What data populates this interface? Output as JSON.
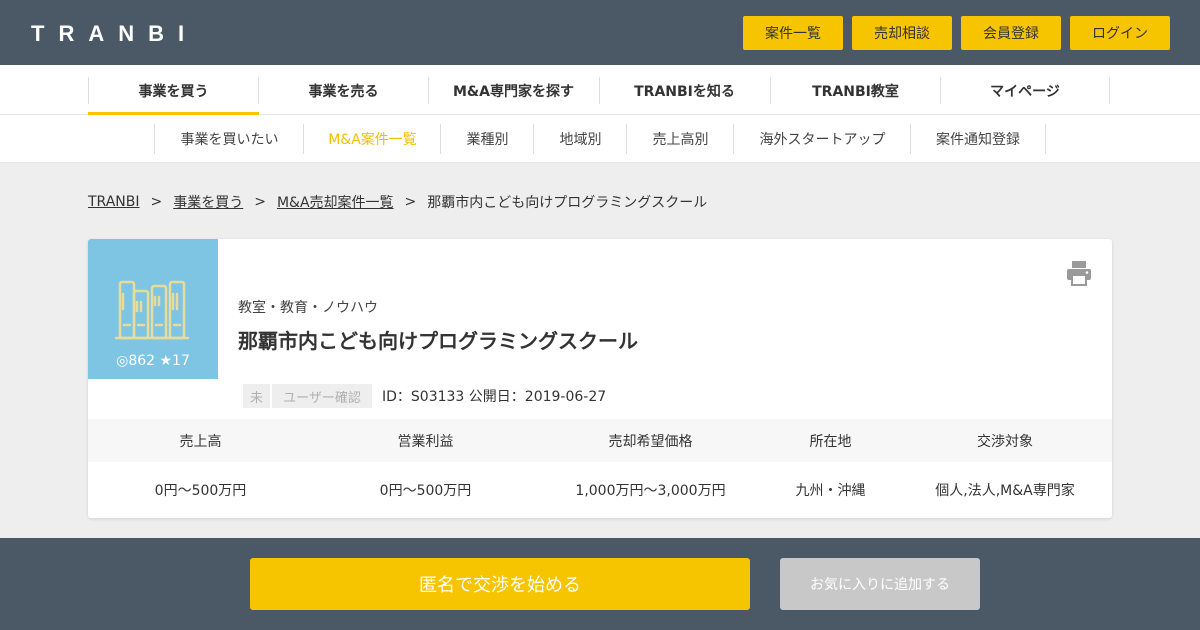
{
  "header": {
    "logo": "TRANBI",
    "buttons": [
      "案件一覧",
      "売却相談",
      "会員登録",
      "ログイン"
    ]
  },
  "main_nav": {
    "items": [
      "事業を買う",
      "事業を売る",
      "M&A専門家を探す",
      "TRANBIを知る",
      "TRANBI教室",
      "マイページ"
    ],
    "active": "事業を買う"
  },
  "sub_nav": {
    "items": [
      "事業を買いたい",
      "M&A案件一覧",
      "業種別",
      "地域別",
      "売上高別",
      "海外スタートアップ",
      "案件通知登録"
    ],
    "active": "M&A案件一覧"
  },
  "breadcrumb": {
    "items": [
      "TRANBI",
      "事業を買う",
      "M&A売却案件一覧",
      "那覇市内こども向けプログラミングスクール"
    ],
    "separator": ">"
  },
  "listing": {
    "stats": "◎862 ★17",
    "category": "教室・教育・ノウハウ",
    "title": "那覇市内こども向けプログラミングスクール",
    "badge_short": "未",
    "badge_long": "ユーザー確認",
    "meta": "ID：S03133 公開日：2019-06-27",
    "table_headers": [
      "売上高",
      "営業利益",
      "売却希望価格",
      "所在地",
      "交渉対象"
    ],
    "table_values": [
      "0円〜500万円",
      "0円〜500万円",
      "1,000万円〜3,000万円",
      "九州・沖縄",
      "個人,法人,M&A専門家"
    ]
  },
  "actions": {
    "negotiate": "匿名で交渉を始める",
    "favorite": "お気に入りに追加する"
  },
  "colors": {
    "header_bg": "#4b5966",
    "accent_yellow": "#f7c400",
    "thumb_blue": "#7ec4e3",
    "page_bg": "#eeeeee"
  },
  "icons": {
    "print": "printer-icon",
    "thumbnail": "books-icon"
  }
}
